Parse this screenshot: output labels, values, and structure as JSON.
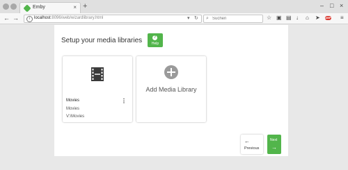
{
  "browser": {
    "tab_title": "Emby",
    "tab_close": "×",
    "new_tab": "+",
    "url_host": "localhost",
    "url_path": ":8096/web/wizardlibrary.html",
    "search_placeholder": "Suchen",
    "icons": [
      "back-icon",
      "forward-icon",
      "info-icon",
      "reload-icon",
      "search-icon",
      "star-icon",
      "clipboard-icon",
      "lock-icon",
      "download-icon",
      "home-icon",
      "send-icon",
      "adblock-icon",
      "menu-icon"
    ],
    "adblock_badge": "ABP"
  },
  "page": {
    "title": "Setup your media libraries",
    "help_label": "Help",
    "help_icon": "?",
    "accent": "#52b54b",
    "libraries": [
      {
        "name": "Movies",
        "type": "Movies",
        "path": "V:\\Movies",
        "icon": "film-icon"
      }
    ],
    "add_library_label": "Add Media Library",
    "previous_label": "Previous",
    "next_label": "Next"
  }
}
